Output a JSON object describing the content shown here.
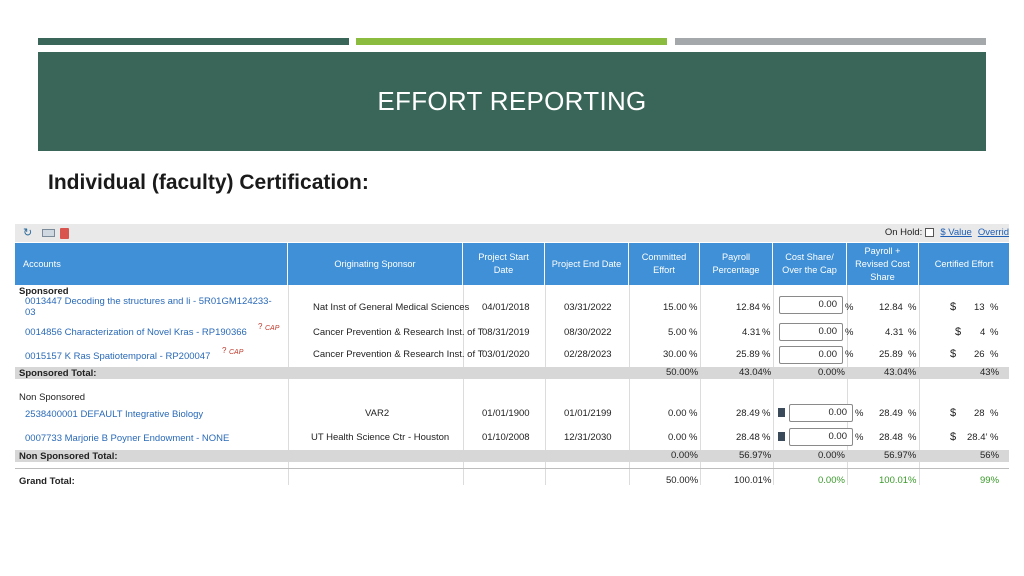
{
  "slide": {
    "title": "EFFORT REPORTING",
    "subtitle": "Individual (faculty) Certification:"
  },
  "colors": {
    "dark_green": "#3a6659",
    "light_green": "#8cbc3f",
    "gray": "#a5a8ab",
    "header_blue": "#3f90d6"
  },
  "toolbar": {
    "icons": [
      "refresh-icon",
      "keyboard-icon",
      "pdf-icon"
    ],
    "on_hold_label": "On Hold:",
    "value_link": "$ Value",
    "override_link": "Overrid"
  },
  "columns": {
    "accounts": "Accounts",
    "sponsor": "Originating Sponsor",
    "start": "Project Start Date",
    "end": "Project End Date",
    "committed": "Committed Effort",
    "payroll": "Payroll Percentage",
    "cost_share": "Cost Share/ Over the Cap",
    "revised": "Payroll + Revised Cost Share",
    "certified": "Certified Effort"
  },
  "sponsored": {
    "label": "Sponsored",
    "rows": [
      {
        "account_l1": "0013447  Decoding the structures and li - 5R01GM124233-",
        "account_l2": "03",
        "sponsor": "Nat Inst of General Medical Sciences",
        "start": "04/01/2018",
        "end": "03/31/2022",
        "committed": "15.00",
        "payroll": "12.84",
        "cost_share": "0.00",
        "revised": "12.84",
        "certified": "13",
        "flag": ""
      },
      {
        "account_l1": "0014856  Characterization of Novel Kras - RP190366",
        "account_l2": "",
        "sponsor": "Cancer Prevention & Research Inst. of T",
        "start": "08/31/2019",
        "end": "08/30/2022",
        "committed": "5.00",
        "payroll": "4.31",
        "cost_share": "0.00",
        "revised": "4.31",
        "certified": "4",
        "flag": "CAP"
      },
      {
        "account_l1": "0015157  K Ras Spatiotemporal - RP200047",
        "account_l2": "",
        "sponsor": "Cancer Prevention & Research Inst. of T",
        "start": "03/01/2020",
        "end": "02/28/2023",
        "committed": "30.00",
        "payroll": "25.89",
        "cost_share": "0.00",
        "revised": "25.89",
        "certified": "26",
        "flag": "CAP"
      }
    ],
    "total_label": "Sponsored Total:",
    "total": {
      "committed": "50.00%",
      "payroll": "43.04%",
      "cost_share": "0.00%",
      "revised": "43.04%",
      "certified": "43%"
    }
  },
  "non_sponsored": {
    "label": "Non Sponsored",
    "rows": [
      {
        "account_l1": "2538400001 DEFAULT  Integrative Biology",
        "sponsor": "VAR2",
        "start": "01/01/1900",
        "end": "01/01/2199",
        "committed": "0.00",
        "payroll": "28.49",
        "cost_share": "0.00",
        "revised": "28.49",
        "certified": "28"
      },
      {
        "account_l1": "0007733  Marjorie B  Poyner Endowment - NONE",
        "sponsor": "UT Health Science Ctr - Houston",
        "start": "01/10/2008",
        "end": "12/31/2030",
        "committed": "0.00",
        "payroll": "28.48",
        "cost_share": "0.00",
        "revised": "28.48",
        "certified": "28.4’"
      }
    ],
    "total_label": "Non Sponsored Total:",
    "total": {
      "committed": "0.00%",
      "payroll": "56.97%",
      "cost_share": "0.00%",
      "revised": "56.97%",
      "certified": "56%"
    }
  },
  "grand_total": {
    "label": "Grand Total:",
    "committed": "50.00%",
    "payroll": "100.01%",
    "cost_share": "0.00%",
    "revised": "100.01%",
    "certified": "99%"
  },
  "symbols": {
    "percent": "%",
    "dollar": "$",
    "question": "?",
    "cap": "CAP"
  }
}
